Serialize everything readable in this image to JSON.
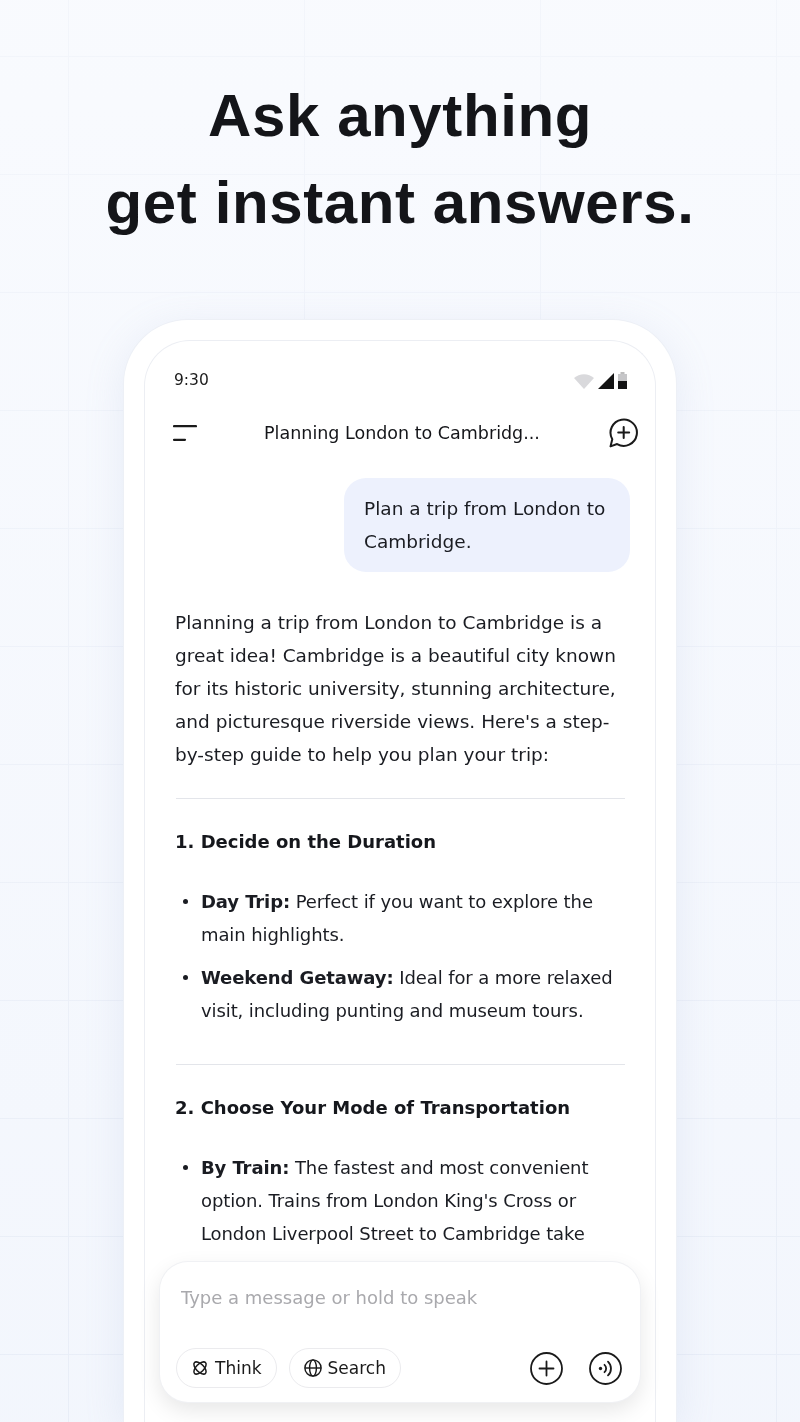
{
  "headline": "Ask anything\nget instant answers.",
  "status_bar": {
    "time": "9:30"
  },
  "header": {
    "title": "Planning London to Cambridg..."
  },
  "conversation": [
    {
      "kind": "user",
      "text": "Plan a trip from London to Cambridge."
    },
    {
      "kind": "paragraph",
      "text": "Planning a trip from London to Cambridge is a great idea! Cambridge is a beautiful city known for its historic university, stunning architecture, and picturesque riverside views. Here's a step-by-step guide to help you plan your trip:"
    },
    {
      "kind": "rule"
    },
    {
      "kind": "heading",
      "text": "1. Decide on the Duration"
    },
    {
      "kind": "bullet",
      "text": "**Day Trip:** Perfect if you want to explore the main highlights."
    },
    {
      "kind": "bullet",
      "text": "**Weekend Getaway:** Ideal for a more relaxed visit, including punting and museum tours."
    },
    {
      "kind": "rule"
    },
    {
      "kind": "heading",
      "text": "2. Choose Your Mode of Transportation"
    },
    {
      "kind": "bullet",
      "text": "**By Train:** The fastest and most convenient option. Trains from London King's Cross or London Liverpool Street to Cambridge take"
    }
  ],
  "composer": {
    "placeholder": "Type a message or hold to speak",
    "tools": [
      {
        "kind": "think",
        "label": "Think",
        "selected": false
      },
      {
        "kind": "search",
        "label": "Search",
        "selected": false
      }
    ]
  }
}
